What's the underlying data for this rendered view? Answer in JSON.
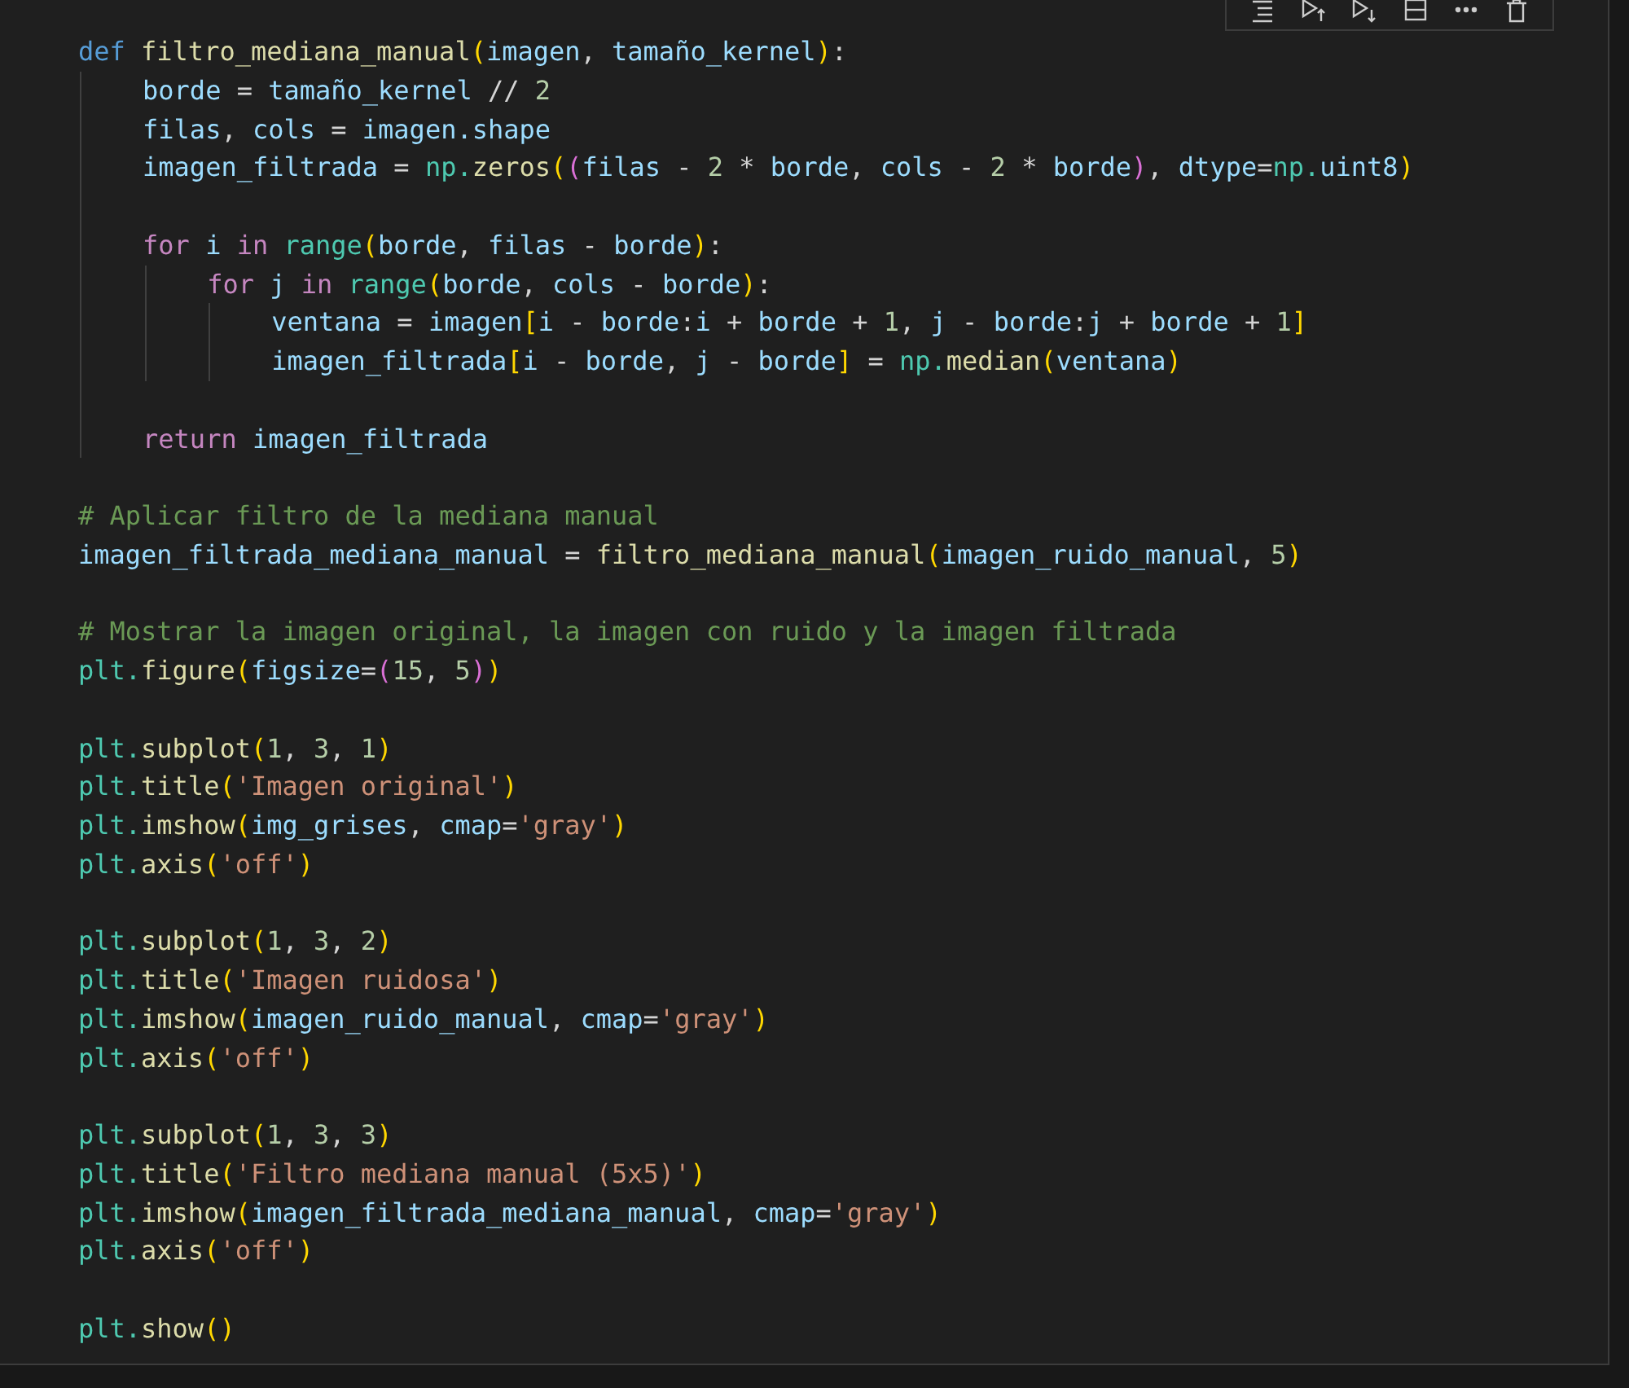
{
  "toolbar": {
    "buttons": [
      {
        "kind": "run-by-line"
      },
      {
        "kind": "run-above"
      },
      {
        "kind": "run-below"
      },
      {
        "kind": "split"
      },
      {
        "kind": "more"
      },
      {
        "kind": "delete"
      }
    ]
  },
  "code": [
    {
      "kind": "code",
      "tokens": [
        {
          "kind": "kw",
          "text": "def "
        },
        {
          "kind": "fn",
          "text": "filtro_mediana_manual"
        },
        {
          "kind": "b1",
          "text": "("
        },
        {
          "kind": "var",
          "text": "imagen"
        },
        {
          "kind": "op",
          "text": ", "
        },
        {
          "kind": "var",
          "text": "tamaño_kernel"
        },
        {
          "kind": "b1",
          "text": ")"
        },
        {
          "kind": "op",
          "text": ":"
        }
      ],
      "children": [
        {
          "kind": "code",
          "tokens": [
            {
              "kind": "var",
              "text": "borde"
            },
            {
              "kind": "op",
              "text": " = "
            },
            {
              "kind": "var",
              "text": "tamaño_kernel"
            },
            {
              "kind": "op",
              "text": " // "
            },
            {
              "kind": "num",
              "text": "2"
            }
          ]
        },
        {
          "kind": "code",
          "tokens": [
            {
              "kind": "var",
              "text": "filas"
            },
            {
              "kind": "op",
              "text": ", "
            },
            {
              "kind": "var",
              "text": "cols"
            },
            {
              "kind": "op",
              "text": " = "
            },
            {
              "kind": "var",
              "text": "imagen.shape"
            }
          ]
        },
        {
          "kind": "code",
          "tokens": [
            {
              "kind": "var",
              "text": "imagen_filtrada"
            },
            {
              "kind": "op",
              "text": " = "
            },
            {
              "kind": "mod",
              "text": "np."
            },
            {
              "kind": "fn",
              "text": "zeros"
            },
            {
              "kind": "b1",
              "text": "("
            },
            {
              "kind": "b2",
              "text": "("
            },
            {
              "kind": "var",
              "text": "filas"
            },
            {
              "kind": "op",
              "text": " - "
            },
            {
              "kind": "num",
              "text": "2"
            },
            {
              "kind": "op",
              "text": " * "
            },
            {
              "kind": "var",
              "text": "borde"
            },
            {
              "kind": "op",
              "text": ", "
            },
            {
              "kind": "var",
              "text": "cols"
            },
            {
              "kind": "op",
              "text": " - "
            },
            {
              "kind": "num",
              "text": "2"
            },
            {
              "kind": "op",
              "text": " * "
            },
            {
              "kind": "var",
              "text": "borde"
            },
            {
              "kind": "b2",
              "text": ")"
            },
            {
              "kind": "op",
              "text": ", "
            },
            {
              "kind": "var",
              "text": "dtype"
            },
            {
              "kind": "op",
              "text": "="
            },
            {
              "kind": "mod",
              "text": "np."
            },
            {
              "kind": "var",
              "text": "uint8"
            },
            {
              "kind": "b1",
              "text": ")"
            }
          ]
        },
        {
          "kind": "blank"
        },
        {
          "kind": "code",
          "tokens": [
            {
              "kind": "ctl",
              "text": "for "
            },
            {
              "kind": "var",
              "text": "i "
            },
            {
              "kind": "ctl",
              "text": "in "
            },
            {
              "kind": "mod",
              "text": "range"
            },
            {
              "kind": "b1",
              "text": "("
            },
            {
              "kind": "var",
              "text": "borde"
            },
            {
              "kind": "op",
              "text": ", "
            },
            {
              "kind": "var",
              "text": "filas"
            },
            {
              "kind": "op",
              "text": " - "
            },
            {
              "kind": "var",
              "text": "borde"
            },
            {
              "kind": "b1",
              "text": ")"
            },
            {
              "kind": "op",
              "text": ":"
            }
          ],
          "children": [
            {
              "kind": "code",
              "tokens": [
                {
                  "kind": "ctl",
                  "text": "for "
                },
                {
                  "kind": "var",
                  "text": "j "
                },
                {
                  "kind": "ctl",
                  "text": "in "
                },
                {
                  "kind": "mod",
                  "text": "range"
                },
                {
                  "kind": "b1",
                  "text": "("
                },
                {
                  "kind": "var",
                  "text": "borde"
                },
                {
                  "kind": "op",
                  "text": ", "
                },
                {
                  "kind": "var",
                  "text": "cols"
                },
                {
                  "kind": "op",
                  "text": " - "
                },
                {
                  "kind": "var",
                  "text": "borde"
                },
                {
                  "kind": "b1",
                  "text": ")"
                },
                {
                  "kind": "op",
                  "text": ":"
                }
              ],
              "children": [
                {
                  "kind": "code",
                  "tokens": [
                    {
                      "kind": "var",
                      "text": "ventana"
                    },
                    {
                      "kind": "op",
                      "text": " = "
                    },
                    {
                      "kind": "var",
                      "text": "imagen"
                    },
                    {
                      "kind": "b1",
                      "text": "["
                    },
                    {
                      "kind": "var",
                      "text": "i"
                    },
                    {
                      "kind": "op",
                      "text": " - "
                    },
                    {
                      "kind": "var",
                      "text": "borde"
                    },
                    {
                      "kind": "op",
                      "text": ":"
                    },
                    {
                      "kind": "var",
                      "text": "i"
                    },
                    {
                      "kind": "op",
                      "text": " + "
                    },
                    {
                      "kind": "var",
                      "text": "borde"
                    },
                    {
                      "kind": "op",
                      "text": " + "
                    },
                    {
                      "kind": "num",
                      "text": "1"
                    },
                    {
                      "kind": "op",
                      "text": ", "
                    },
                    {
                      "kind": "var",
                      "text": "j"
                    },
                    {
                      "kind": "op",
                      "text": " - "
                    },
                    {
                      "kind": "var",
                      "text": "borde"
                    },
                    {
                      "kind": "op",
                      "text": ":"
                    },
                    {
                      "kind": "var",
                      "text": "j"
                    },
                    {
                      "kind": "op",
                      "text": " + "
                    },
                    {
                      "kind": "var",
                      "text": "borde"
                    },
                    {
                      "kind": "op",
                      "text": " + "
                    },
                    {
                      "kind": "num",
                      "text": "1"
                    },
                    {
                      "kind": "b1",
                      "text": "]"
                    }
                  ]
                },
                {
                  "kind": "code",
                  "tokens": [
                    {
                      "kind": "var",
                      "text": "imagen_filtrada"
                    },
                    {
                      "kind": "b1",
                      "text": "["
                    },
                    {
                      "kind": "var",
                      "text": "i"
                    },
                    {
                      "kind": "op",
                      "text": " - "
                    },
                    {
                      "kind": "var",
                      "text": "borde"
                    },
                    {
                      "kind": "op",
                      "text": ", "
                    },
                    {
                      "kind": "var",
                      "text": "j"
                    },
                    {
                      "kind": "op",
                      "text": " - "
                    },
                    {
                      "kind": "var",
                      "text": "borde"
                    },
                    {
                      "kind": "b1",
                      "text": "]"
                    },
                    {
                      "kind": "op",
                      "text": " = "
                    },
                    {
                      "kind": "mod",
                      "text": "np."
                    },
                    {
                      "kind": "fn",
                      "text": "median"
                    },
                    {
                      "kind": "b1",
                      "text": "("
                    },
                    {
                      "kind": "var",
                      "text": "ventana"
                    },
                    {
                      "kind": "b1",
                      "text": ")"
                    }
                  ]
                }
              ]
            }
          ]
        },
        {
          "kind": "blank"
        },
        {
          "kind": "code",
          "tokens": [
            {
              "kind": "ctl",
              "text": "return "
            },
            {
              "kind": "var",
              "text": "imagen_filtrada"
            }
          ]
        }
      ]
    },
    {
      "kind": "blank"
    },
    {
      "kind": "code",
      "tokens": [
        {
          "kind": "cmt",
          "text": "# Aplicar filtro de la mediana manual"
        }
      ]
    },
    {
      "kind": "code",
      "tokens": [
        {
          "kind": "var",
          "text": "imagen_filtrada_mediana_manual"
        },
        {
          "kind": "op",
          "text": " = "
        },
        {
          "kind": "fn",
          "text": "filtro_mediana_manual"
        },
        {
          "kind": "b1",
          "text": "("
        },
        {
          "kind": "var",
          "text": "imagen_ruido_manual"
        },
        {
          "kind": "op",
          "text": ", "
        },
        {
          "kind": "num",
          "text": "5"
        },
        {
          "kind": "b1",
          "text": ")"
        }
      ]
    },
    {
      "kind": "blank"
    },
    {
      "kind": "code",
      "tokens": [
        {
          "kind": "cmt",
          "text": "# Mostrar la imagen original, la imagen con ruido y la imagen filtrada"
        }
      ]
    },
    {
      "kind": "code",
      "tokens": [
        {
          "kind": "mod",
          "text": "plt."
        },
        {
          "kind": "fn",
          "text": "figure"
        },
        {
          "kind": "b1",
          "text": "("
        },
        {
          "kind": "var",
          "text": "figsize"
        },
        {
          "kind": "op",
          "text": "="
        },
        {
          "kind": "b2",
          "text": "("
        },
        {
          "kind": "num",
          "text": "15"
        },
        {
          "kind": "op",
          "text": ", "
        },
        {
          "kind": "num",
          "text": "5"
        },
        {
          "kind": "b2",
          "text": ")"
        },
        {
          "kind": "b1",
          "text": ")"
        }
      ]
    },
    {
      "kind": "blank"
    },
    {
      "kind": "code",
      "tokens": [
        {
          "kind": "mod",
          "text": "plt."
        },
        {
          "kind": "fn",
          "text": "subplot"
        },
        {
          "kind": "b1",
          "text": "("
        },
        {
          "kind": "num",
          "text": "1"
        },
        {
          "kind": "op",
          "text": ", "
        },
        {
          "kind": "num",
          "text": "3"
        },
        {
          "kind": "op",
          "text": ", "
        },
        {
          "kind": "num",
          "text": "1"
        },
        {
          "kind": "b1",
          "text": ")"
        }
      ]
    },
    {
      "kind": "code",
      "tokens": [
        {
          "kind": "mod",
          "text": "plt."
        },
        {
          "kind": "fn",
          "text": "title"
        },
        {
          "kind": "b1",
          "text": "("
        },
        {
          "kind": "str",
          "text": "'Imagen original'"
        },
        {
          "kind": "b1",
          "text": ")"
        }
      ]
    },
    {
      "kind": "code",
      "tokens": [
        {
          "kind": "mod",
          "text": "plt."
        },
        {
          "kind": "fn",
          "text": "imshow"
        },
        {
          "kind": "b1",
          "text": "("
        },
        {
          "kind": "var",
          "text": "img_grises"
        },
        {
          "kind": "op",
          "text": ", "
        },
        {
          "kind": "var",
          "text": "cmap"
        },
        {
          "kind": "op",
          "text": "="
        },
        {
          "kind": "str",
          "text": "'gray'"
        },
        {
          "kind": "b1",
          "text": ")"
        }
      ]
    },
    {
      "kind": "code",
      "tokens": [
        {
          "kind": "mod",
          "text": "plt."
        },
        {
          "kind": "fn",
          "text": "axis"
        },
        {
          "kind": "b1",
          "text": "("
        },
        {
          "kind": "str",
          "text": "'off'"
        },
        {
          "kind": "b1",
          "text": ")"
        }
      ]
    },
    {
      "kind": "blank"
    },
    {
      "kind": "code",
      "tokens": [
        {
          "kind": "mod",
          "text": "plt."
        },
        {
          "kind": "fn",
          "text": "subplot"
        },
        {
          "kind": "b1",
          "text": "("
        },
        {
          "kind": "num",
          "text": "1"
        },
        {
          "kind": "op",
          "text": ", "
        },
        {
          "kind": "num",
          "text": "3"
        },
        {
          "kind": "op",
          "text": ", "
        },
        {
          "kind": "num",
          "text": "2"
        },
        {
          "kind": "b1",
          "text": ")"
        }
      ]
    },
    {
      "kind": "code",
      "tokens": [
        {
          "kind": "mod",
          "text": "plt."
        },
        {
          "kind": "fn",
          "text": "title"
        },
        {
          "kind": "b1",
          "text": "("
        },
        {
          "kind": "str",
          "text": "'Imagen ruidosa'"
        },
        {
          "kind": "b1",
          "text": ")"
        }
      ]
    },
    {
      "kind": "code",
      "tokens": [
        {
          "kind": "mod",
          "text": "plt."
        },
        {
          "kind": "fn",
          "text": "imshow"
        },
        {
          "kind": "b1",
          "text": "("
        },
        {
          "kind": "var",
          "text": "imagen_ruido_manual"
        },
        {
          "kind": "op",
          "text": ", "
        },
        {
          "kind": "var",
          "text": "cmap"
        },
        {
          "kind": "op",
          "text": "="
        },
        {
          "kind": "str",
          "text": "'gray'"
        },
        {
          "kind": "b1",
          "text": ")"
        }
      ]
    },
    {
      "kind": "code",
      "tokens": [
        {
          "kind": "mod",
          "text": "plt."
        },
        {
          "kind": "fn",
          "text": "axis"
        },
        {
          "kind": "b1",
          "text": "("
        },
        {
          "kind": "str",
          "text": "'off'"
        },
        {
          "kind": "b1",
          "text": ")"
        }
      ]
    },
    {
      "kind": "blank"
    },
    {
      "kind": "code",
      "tokens": [
        {
          "kind": "mod",
          "text": "plt."
        },
        {
          "kind": "fn",
          "text": "subplot"
        },
        {
          "kind": "b1",
          "text": "("
        },
        {
          "kind": "num",
          "text": "1"
        },
        {
          "kind": "op",
          "text": ", "
        },
        {
          "kind": "num",
          "text": "3"
        },
        {
          "kind": "op",
          "text": ", "
        },
        {
          "kind": "num",
          "text": "3"
        },
        {
          "kind": "b1",
          "text": ")"
        }
      ]
    },
    {
      "kind": "code",
      "tokens": [
        {
          "kind": "mod",
          "text": "plt."
        },
        {
          "kind": "fn",
          "text": "title"
        },
        {
          "kind": "b1",
          "text": "("
        },
        {
          "kind": "str",
          "text": "'Filtro mediana manual (5x5)'"
        },
        {
          "kind": "b1",
          "text": ")"
        }
      ]
    },
    {
      "kind": "code",
      "tokens": [
        {
          "kind": "mod",
          "text": "plt."
        },
        {
          "kind": "fn",
          "text": "imshow"
        },
        {
          "kind": "b1",
          "text": "("
        },
        {
          "kind": "var",
          "text": "imagen_filtrada_mediana_manual"
        },
        {
          "kind": "op",
          "text": ", "
        },
        {
          "kind": "var",
          "text": "cmap"
        },
        {
          "kind": "op",
          "text": "="
        },
        {
          "kind": "str",
          "text": "'gray'"
        },
        {
          "kind": "b1",
          "text": ")"
        }
      ]
    },
    {
      "kind": "code",
      "tokens": [
        {
          "kind": "mod",
          "text": "plt."
        },
        {
          "kind": "fn",
          "text": "axis"
        },
        {
          "kind": "b1",
          "text": "("
        },
        {
          "kind": "str",
          "text": "'off'"
        },
        {
          "kind": "b1",
          "text": ")"
        }
      ]
    },
    {
      "kind": "blank"
    },
    {
      "kind": "code",
      "tokens": [
        {
          "kind": "mod",
          "text": "plt."
        },
        {
          "kind": "fn",
          "text": "show"
        },
        {
          "kind": "b1",
          "text": "()"
        }
      ]
    }
  ]
}
